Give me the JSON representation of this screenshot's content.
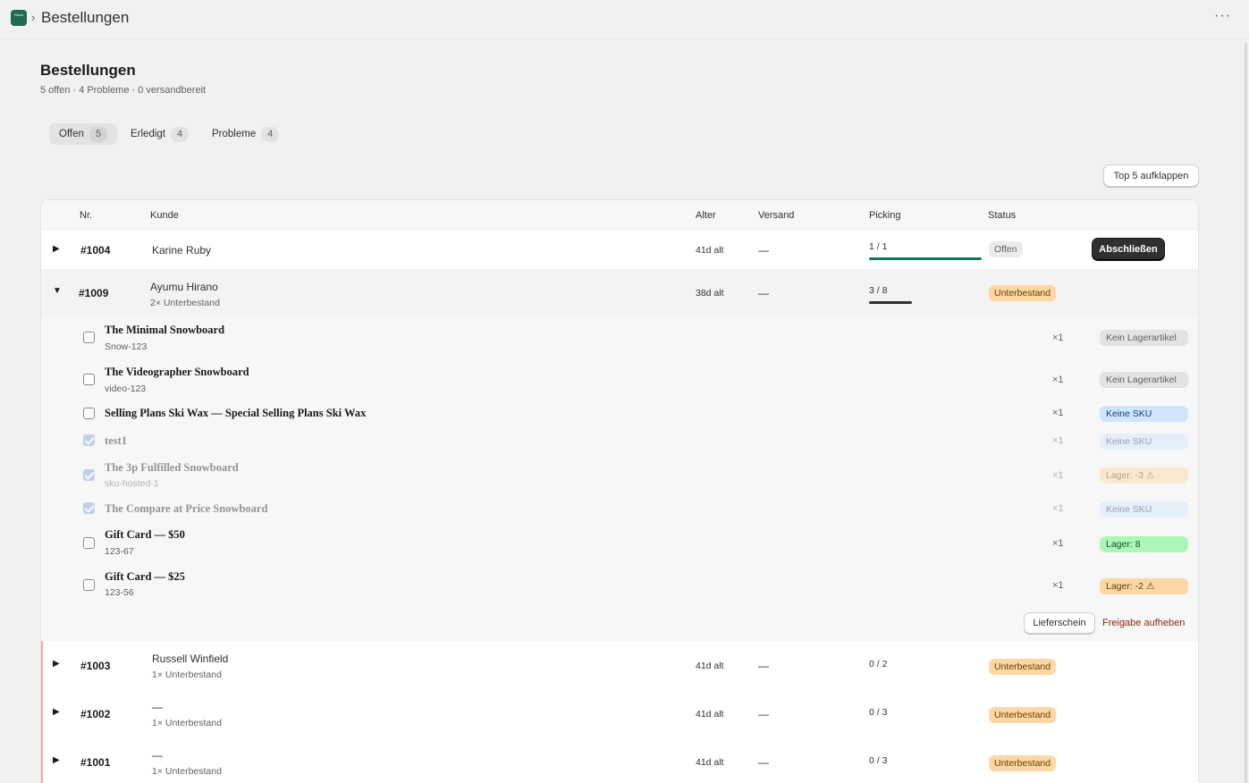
{
  "topbar": {
    "app_icon_text": "Stock",
    "separator": "›",
    "title": "Bestellungen",
    "more": "···"
  },
  "page": {
    "title": "Bestellungen",
    "subtitle": "5 offen · 4 Probleme · 0 versandbereit"
  },
  "tabs": [
    {
      "label": "Offen",
      "count": "5",
      "active": true
    },
    {
      "label": "Erledigt",
      "count": "4",
      "active": false
    },
    {
      "label": "Probleme",
      "count": "4",
      "active": false
    }
  ],
  "expand_button": "Top 5 aufklappen",
  "table": {
    "headers": {
      "nr": "Nr.",
      "kunde": "Kunde",
      "alter": "Alter",
      "versand": "Versand",
      "picking": "Picking",
      "status": "Status"
    }
  },
  "orders": {
    "o1004": {
      "caret": "▶",
      "number": "#1004",
      "customer": "Karine Ruby",
      "age": "41d alt",
      "shipping": "—",
      "picking": "1 / 1",
      "picking_fraction": 1.0,
      "status": "Offen",
      "action": "Abschließen"
    },
    "o1009": {
      "caret": "▼",
      "number": "#1009",
      "customer": "Ayumu Hirano",
      "customer_sub": "2× Unterbestand",
      "age": "38d alt",
      "shipping": "—",
      "picking": "3 / 8",
      "picking_fraction": 0.375,
      "status": "Unterbestand"
    },
    "o1003": {
      "caret": "▶",
      "number": "#1003",
      "customer": "Russell Winfield",
      "customer_sub": "1× Unterbestand",
      "age": "41d alt",
      "shipping": "—",
      "picking": "0 / 2",
      "status": "Unterbestand"
    },
    "o1002": {
      "caret": "▶",
      "number": "#1002",
      "customer": "—",
      "customer_sub": "1× Unterbestand",
      "age": "41d alt",
      "shipping": "—",
      "picking": "0 / 3",
      "status": "Unterbestand"
    },
    "o1001": {
      "caret": "▶",
      "number": "#1001",
      "customer": "—",
      "customer_sub": "1× Unterbestand",
      "age": "41d alt",
      "shipping": "—",
      "picking": "0 / 3",
      "status": "Unterbestand"
    }
  },
  "items": [
    {
      "name": "The Minimal Snowboard",
      "sku": "Snow-123",
      "qty": "×1",
      "badge": "Kein Lagerartikel",
      "checked": false
    },
    {
      "name": "The Videographer Snowboard",
      "sku": "video-123",
      "qty": "×1",
      "badge": "Kein Lagerartikel",
      "checked": false
    },
    {
      "name": "Selling Plans Ski Wax — Special Selling Plans Ski Wax",
      "sku": "",
      "qty": "×1",
      "badge": "Keine SKU",
      "checked": false
    },
    {
      "name": "test1",
      "sku": "",
      "qty": "×1",
      "badge": "Keine SKU",
      "checked": true
    },
    {
      "name": "The 3p Fulfilled Snowboard",
      "sku": "sku-hosted-1",
      "qty": "×1",
      "badge": "Lager: -3 ⚠",
      "checked": true
    },
    {
      "name": "The Compare at Price Snowboard",
      "sku": "",
      "qty": "×1",
      "badge": "Keine SKU",
      "checked": true
    },
    {
      "name": "Gift Card — $50",
      "sku": "123-67",
      "qty": "×1",
      "badge": "Lager: 8",
      "checked": false
    },
    {
      "name": "Gift Card — $25",
      "sku": "123-56",
      "qty": "×1",
      "badge": "Lager: -2 ⚠",
      "checked": false
    }
  ],
  "expanded_actions": {
    "packing_slip": "Lieferschein",
    "release": "Freigabe aufheben"
  },
  "colors": {
    "progress_done": "#047b5d",
    "progress_partial": "#303030",
    "warning_badge": "#ffd6a4",
    "problem_marker": "#f0a6a6"
  }
}
